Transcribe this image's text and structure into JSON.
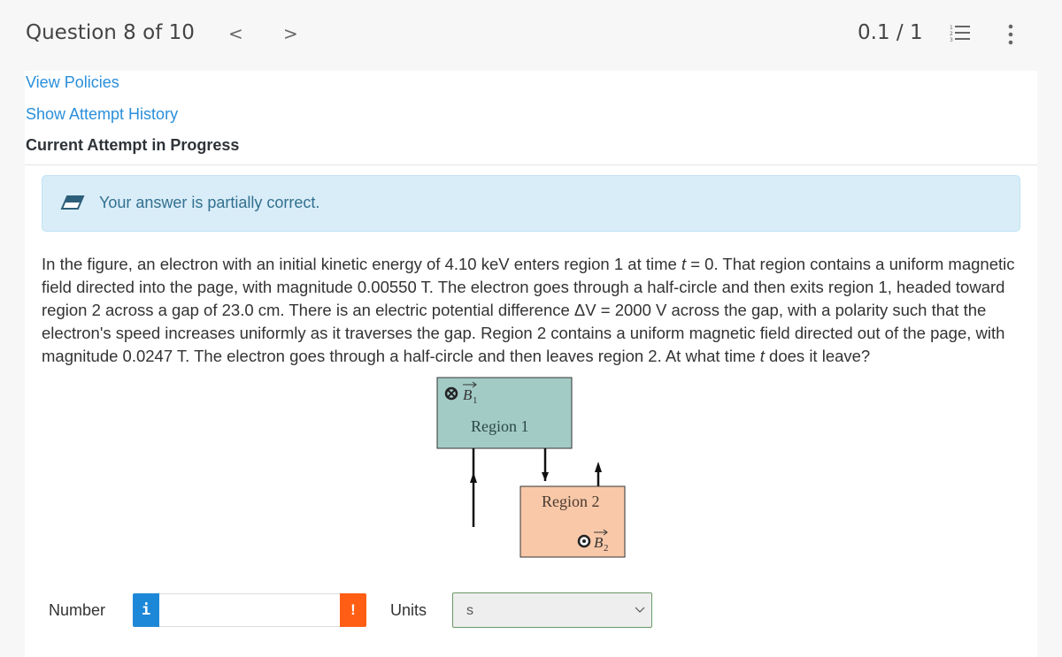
{
  "header": {
    "question_label": "Question 8 of 10",
    "prev_icon": "chevron-left-icon",
    "next_icon": "chevron-right-icon",
    "prev_glyph": "<",
    "next_glyph": ">",
    "score": "0.1 / 1",
    "list_icon": "numbered-list-icon",
    "more_icon": "more-vertical-icon"
  },
  "links": {
    "view_policies": "View Policies",
    "show_attempt_history": "Show Attempt History"
  },
  "attempt_heading": "Current Attempt in Progress",
  "alert": {
    "icon": "eraser-icon",
    "message": "Your answer is partially correct.",
    "colors": {
      "background": "#d9edf8",
      "text": "#32708f"
    }
  },
  "question": {
    "parts": [
      "In the figure, an electron with an initial kinetic energy of 4.10 keV enters region 1 at time ",
      "t",
      " = 0. That region contains a uniform magnetic field directed into the page, with magnitude 0.00550 T. The electron goes through a half-circle and then exits region 1, headed toward region 2 across a gap of 23.0 cm. There is an electric potential difference ΔV = 2000 V across the gap, with a polarity such that the electron's speed increases uniformly as it traverses the gap. Region 2 contains a uniform magnetic field directed out of the page, with magnitude 0.0247 T. The electron goes through a half-circle and then leaves region 2. At what time ",
      "t",
      " does it leave?"
    ]
  },
  "figure": {
    "region1_label": "Region 1",
    "region2_label": "Region 2",
    "b1_label": "B",
    "b1_sub": "1",
    "b2_label": "B",
    "b2_sub": "2",
    "region1_color": "#a3cbc5",
    "region2_color": "#f8c8a8"
  },
  "answer": {
    "number_label": "Number",
    "info_glyph": "i",
    "number_value": "",
    "warning_glyph": "!",
    "units_label": "Units",
    "units_value": "s"
  }
}
